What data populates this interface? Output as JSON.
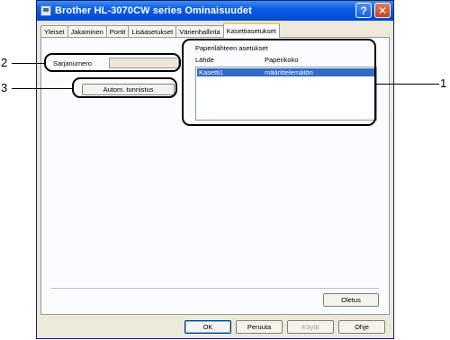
{
  "window": {
    "title": "Brother HL-3070CW series Ominaisuudet",
    "help_label": "?",
    "close_label": "✕"
  },
  "tabs": [
    {
      "label": "Yleiset"
    },
    {
      "label": "Jakaminen"
    },
    {
      "label": "Portit"
    },
    {
      "label": "Lisäasetukset"
    },
    {
      "label": "Värienhallinta"
    },
    {
      "label": "Kasettiasetukset",
      "active": true
    }
  ],
  "serial": {
    "label": "Sarjanumero",
    "value": ""
  },
  "autodetect": {
    "label": "Autom. tunnistus"
  },
  "paper_source": {
    "group_label": "Paperilähteen asetukset",
    "col_source": "Lähde",
    "col_size": "Paperikoko",
    "rows": [
      {
        "source": "Kasetti1",
        "size": "määrittelemätön",
        "selected": true
      }
    ]
  },
  "buttons": {
    "defaults": "Oletus",
    "ok": "OK",
    "cancel": "Peruuta",
    "apply": "Käytä",
    "help": "Ohje"
  },
  "callouts": {
    "one": "1",
    "two": "2",
    "three": "3"
  }
}
